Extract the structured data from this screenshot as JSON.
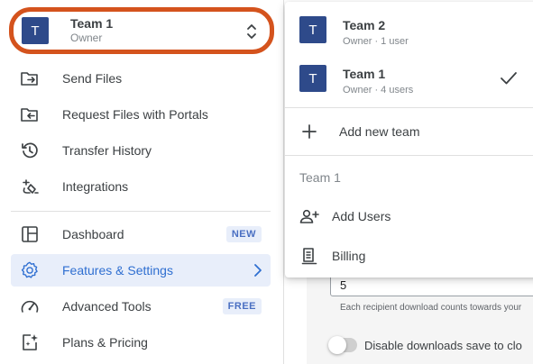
{
  "sidebar": {
    "current_team": {
      "initial": "T",
      "name": "Team 1",
      "role": "Owner"
    },
    "items": [
      {
        "label": "Send Files",
        "icon": "send-files-icon"
      },
      {
        "label": "Request Files with Portals",
        "icon": "request-files-icon"
      },
      {
        "label": "Transfer History",
        "icon": "history-icon"
      },
      {
        "label": "Integrations",
        "icon": "integrations-icon"
      },
      {
        "label": "Dashboard",
        "icon": "dashboard-icon",
        "badge": "NEW"
      },
      {
        "label": "Features & Settings",
        "icon": "gear-icon",
        "active": true
      },
      {
        "label": "Advanced Tools",
        "icon": "speedometer-icon",
        "badge": "FREE"
      },
      {
        "label": "Plans & Pricing",
        "icon": "sparkle-icon"
      }
    ]
  },
  "team_menu": {
    "teams": [
      {
        "initial": "T",
        "name": "Team 2",
        "subtitle": "Owner · 1 user",
        "selected": false
      },
      {
        "initial": "T",
        "name": "Team 1",
        "subtitle": "Owner · 4 users",
        "selected": true
      }
    ],
    "add_team_label": "Add new team",
    "section_title": "Team 1",
    "section_items": [
      {
        "label": "Add Users",
        "icon": "add-user-icon"
      },
      {
        "label": "Billing",
        "icon": "billing-icon"
      }
    ]
  },
  "settings_background": {
    "download_limit_value": "5",
    "download_limit_help": "Each recipient download counts towards your",
    "toggle_label": "Disable downloads save to clo"
  },
  "colors": {
    "accent": "#2f6fd1",
    "avatar_bg": "#2e4a8a",
    "highlight_ring": "#d4531d",
    "active_bg": "#e8eefa"
  }
}
